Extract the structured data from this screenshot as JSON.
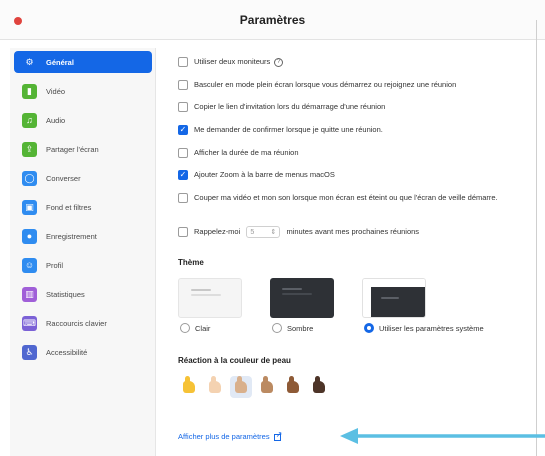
{
  "window": {
    "title": "Paramètres"
  },
  "sidebar": {
    "items": [
      {
        "label": "Général",
        "icon": "gear-icon",
        "color": "#1467e6",
        "glyph": "⚙",
        "active": true
      },
      {
        "label": "Vidéo",
        "icon": "video-icon",
        "color": "#54b435",
        "glyph": "▮",
        "active": false
      },
      {
        "label": "Audio",
        "icon": "headphones-icon",
        "color": "#54b435",
        "glyph": "♫",
        "active": false
      },
      {
        "label": "Partager l'écran",
        "icon": "share-screen-icon",
        "color": "#54b435",
        "glyph": "⇪",
        "active": false
      },
      {
        "label": "Converser",
        "icon": "chat-icon",
        "color": "#2f8cf0",
        "glyph": "◯",
        "active": false
      },
      {
        "label": "Fond et filtres",
        "icon": "background-icon",
        "color": "#2f8cf0",
        "glyph": "▣",
        "active": false
      },
      {
        "label": "Enregistrement",
        "icon": "record-icon",
        "color": "#2f8cf0",
        "glyph": "●",
        "active": false
      },
      {
        "label": "Profil",
        "icon": "profile-icon",
        "color": "#2f8cf0",
        "glyph": "☺",
        "active": false
      },
      {
        "label": "Statistiques",
        "icon": "statistics-icon",
        "color": "#a05fd8",
        "glyph": "▥",
        "active": false
      },
      {
        "label": "Raccourcis clavier",
        "icon": "keyboard-icon",
        "color": "#7b61d6",
        "glyph": "⌨",
        "active": false
      },
      {
        "label": "Accessibilité",
        "icon": "accessibility-icon",
        "color": "#5067d0",
        "glyph": "♿",
        "active": false
      }
    ]
  },
  "options": [
    {
      "label": "Utiliser deux moniteurs",
      "checked": false,
      "help": true
    },
    {
      "label": "Basculer en mode plein écran lorsque vous démarrez ou rejoignez une réunion",
      "checked": false
    },
    {
      "label": "Copier le lien d'invitation lors du démarrage d'une réunion",
      "checked": false
    },
    {
      "label": "Me demander de confirmer lorsque je quitte une réunion.",
      "checked": true
    },
    {
      "label": "Afficher la durée de ma réunion",
      "checked": false
    },
    {
      "label": "Ajouter Zoom à la barre de menus macOS",
      "checked": true
    },
    {
      "label": "Couper ma vidéo et mon son lorsque mon écran est éteint ou que l'écran de veille démarre.",
      "checked": false
    }
  ],
  "reminder": {
    "before": "Rappelez-moi",
    "value": "5",
    "after": "minutes avant mes prochaines réunions",
    "checked": false
  },
  "theme": {
    "title": "Thème",
    "options": [
      {
        "label": "Clair",
        "selected": false
      },
      {
        "label": "Sombre",
        "selected": false
      },
      {
        "label": "Utiliser les paramètres système",
        "selected": true
      }
    ]
  },
  "skin_tone": {
    "title": "Réaction à la couleur de peau",
    "tones": [
      "#f6c236",
      "#f4d2b1",
      "#d9b08c",
      "#bb8a61",
      "#8e5a36",
      "#4d3428"
    ],
    "selected_index": 2
  },
  "more_link": {
    "label": "Afficher plus de paramètres"
  },
  "colors": {
    "accent": "#1467e6",
    "arrow": "#5bbfe3"
  }
}
